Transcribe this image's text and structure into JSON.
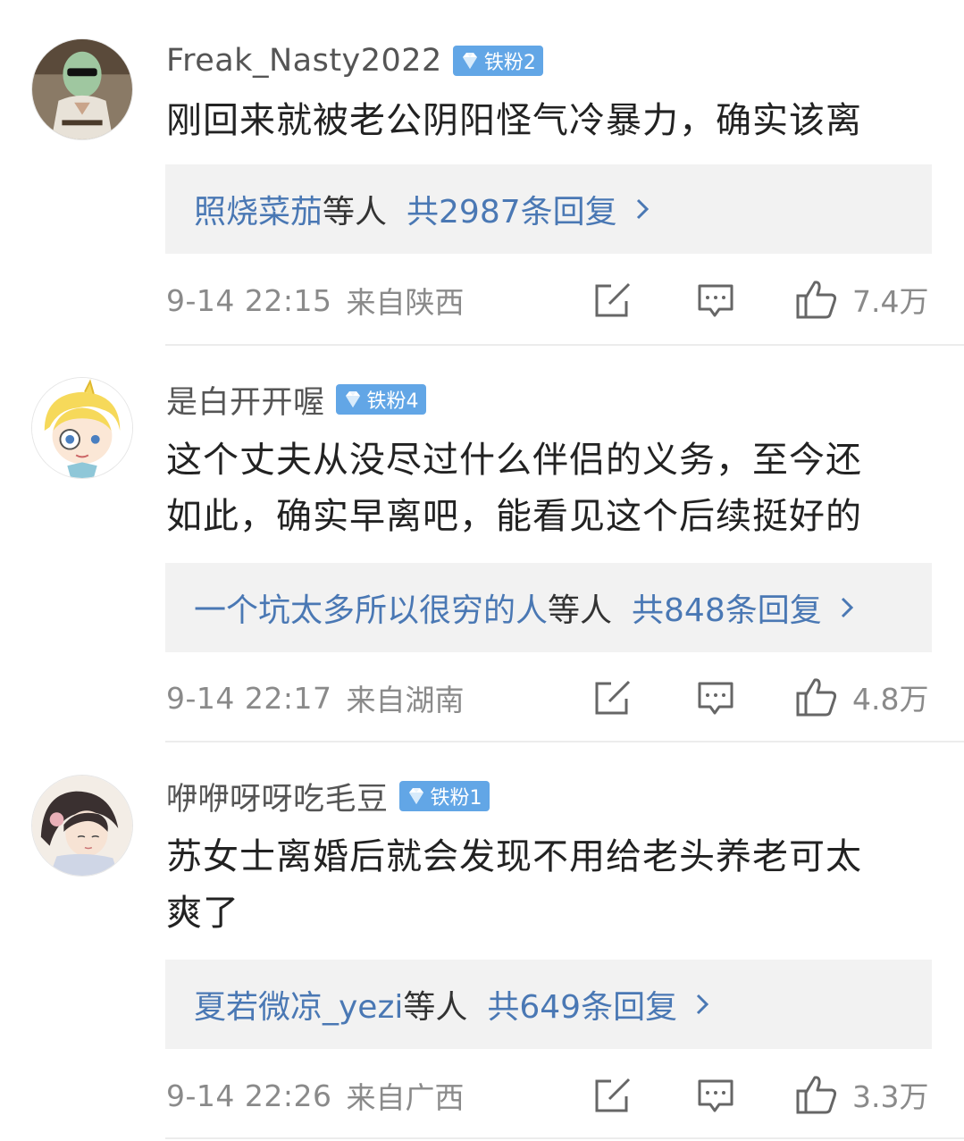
{
  "colors": {
    "badge": "#62a6e6",
    "link": "#4a78b4",
    "reply_box": "#f2f2f2",
    "meta_gray": "#8a8a8a"
  },
  "comments": [
    {
      "username": "Freak_Nasty2022",
      "badge": "铁粉2",
      "lines": [
        "刚回来就被老公阴阳怪气冷暴力，确实该离"
      ],
      "reply_names": "照烧菜茄",
      "reply_suffix": "等人",
      "reply_count": "共2987条回复",
      "time": "9-14 22:15",
      "location": "来自陕西",
      "likes": "7.4万",
      "icons": [
        "share-icon",
        "comment-icon",
        "like-icon"
      ]
    },
    {
      "username": "是白开开喔",
      "badge": "铁粉4",
      "lines": [
        "这个丈夫从没尽过什么伴侣的义务，至今还",
        "如此，确实早离吧，能看见这个后续挺好的"
      ],
      "reply_names": "一个坑太多所以很穷的人",
      "reply_suffix": "等人",
      "reply_count": "共848条回复",
      "time": "9-14 22:17",
      "location": "来自湖南",
      "likes": "4.8万",
      "icons": [
        "share-icon",
        "comment-icon",
        "like-icon"
      ]
    },
    {
      "username": "咿咿呀呀吃毛豆",
      "badge": "铁粉1",
      "lines": [
        "苏女士离婚后就会发现不用给老头养老可太",
        "爽了"
      ],
      "reply_names": "夏若微凉_yezi",
      "reply_suffix": "等人",
      "reply_count": "共649条回复",
      "time": "9-14 22:26",
      "location": "来自广西",
      "likes": "3.3万",
      "icons": [
        "share-icon",
        "comment-icon",
        "like-icon"
      ]
    }
  ]
}
